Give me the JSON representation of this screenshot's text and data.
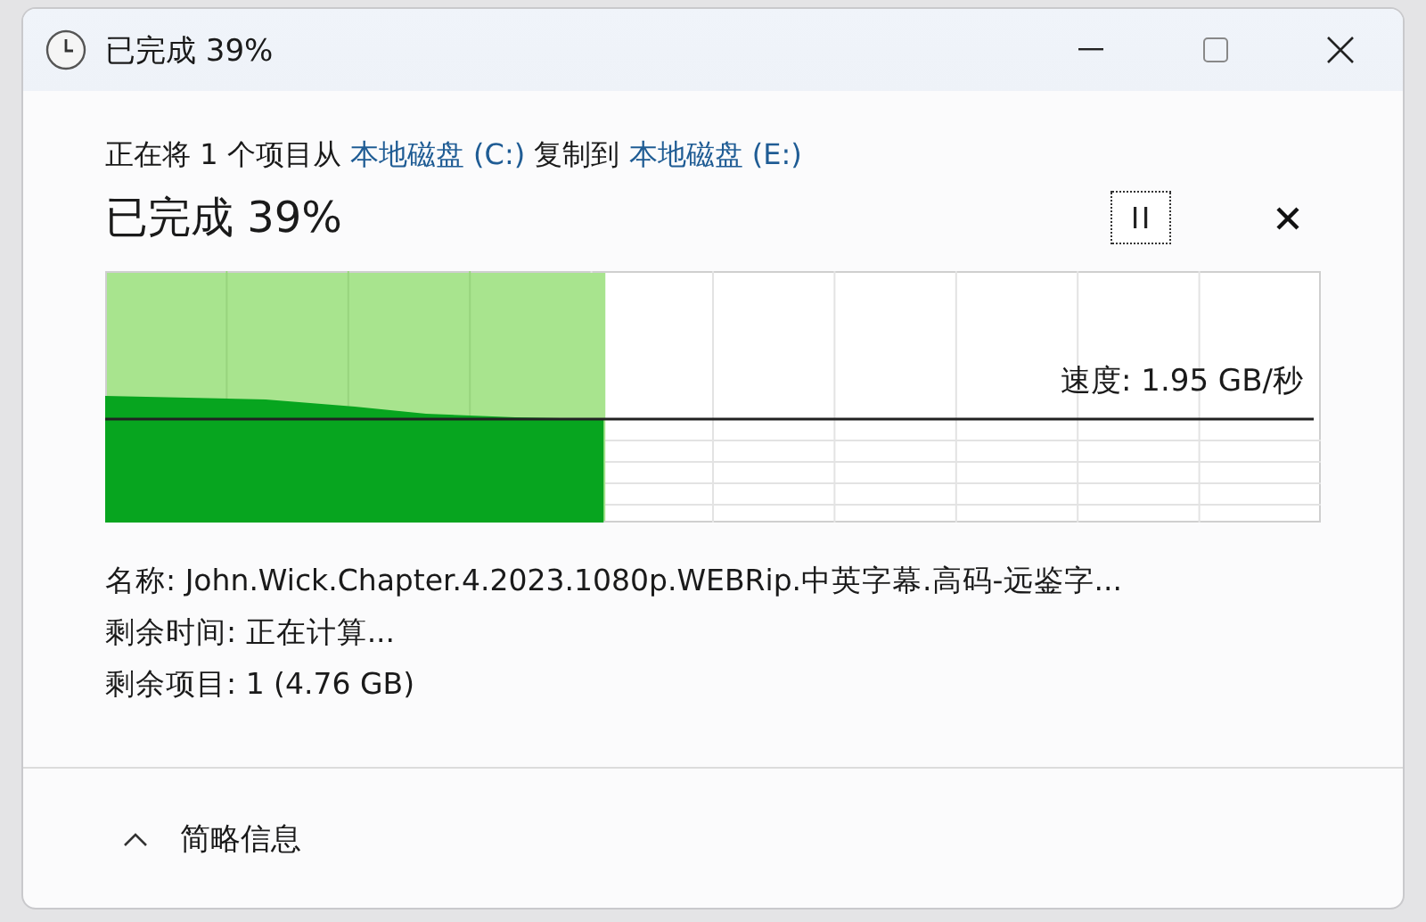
{
  "window": {
    "title": "已完成 39%"
  },
  "copy_line": {
    "prefix": "正在将 1 个项目从 ",
    "source": "本地磁盘 (C:)",
    "middle": " 复制到 ",
    "destination": "本地磁盘 (E:)"
  },
  "heading": "已完成 39%",
  "progress": {
    "level": 0.41,
    "speed": "速度: 1.95 GB/秒"
  },
  "details": [
    {
      "label": "名称:",
      "value": "John.Wick.Chapter.4.2023.1080p.WEBRip.中英字幕.高码-远鉴字..."
    },
    {
      "label": "剩余时间:",
      "value": "正在计算..."
    },
    {
      "label": "剩余项目:",
      "value": "1 (4.76 GB)"
    }
  ],
  "footer": {
    "label": "简略信息",
    "expanded": true
  }
}
